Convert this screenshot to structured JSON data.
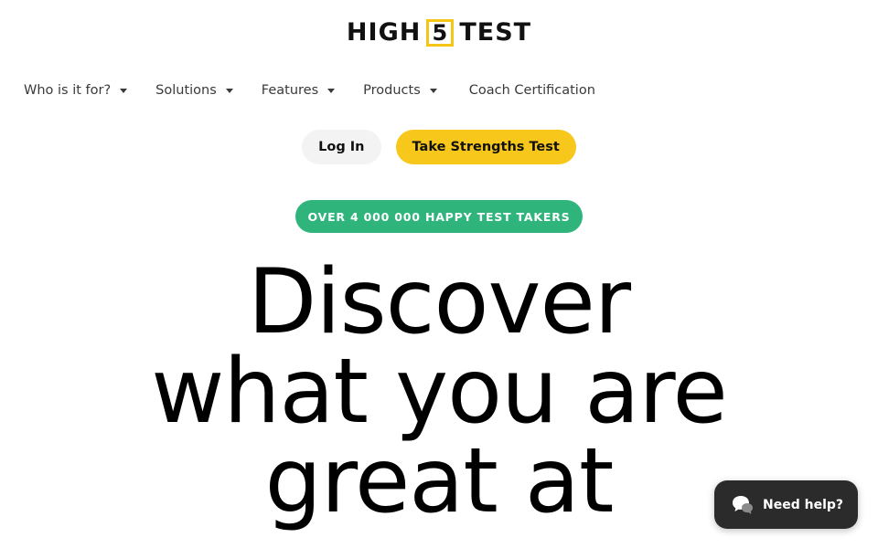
{
  "logo": {
    "left_text": "HIGH",
    "box_text": "5",
    "right_text": "TEST",
    "accent": "#f5c518"
  },
  "nav": {
    "items": [
      {
        "label": "Who is it for?",
        "has_dropdown": true
      },
      {
        "label": "Solutions",
        "has_dropdown": true
      },
      {
        "label": "Features",
        "has_dropdown": true
      },
      {
        "label": "Products",
        "has_dropdown": true
      },
      {
        "label": "Coach Certification",
        "has_dropdown": false
      }
    ]
  },
  "auth": {
    "login_label": "Log In",
    "test_label": "Take Strengths Test",
    "test_color": "#f7c71b"
  },
  "badge": {
    "text": "OVER 4 000 000 HAPPY TEST TAKERS",
    "color": "#2fb57b"
  },
  "hero": {
    "line1": "Discover",
    "line2": "what you are",
    "line3": "great at"
  },
  "help": {
    "label": "Need help?",
    "icon": "chat-bubbles-icon"
  }
}
